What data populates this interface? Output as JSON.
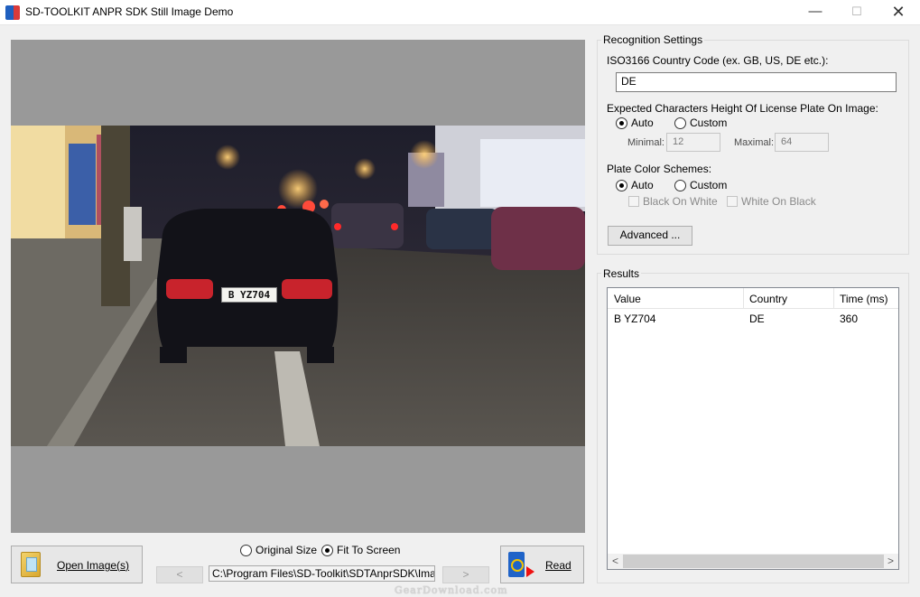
{
  "window": {
    "title": "SD-TOOLKIT ANPR SDK Still Image Demo",
    "controls": {
      "minimize": "—",
      "maximize": "☐",
      "close": "✕"
    }
  },
  "viewer": {
    "plate_text": "B YZ704"
  },
  "toolbar": {
    "open_label": "Open Image(s)",
    "read_label": "Read",
    "original_size_label": "Original Size",
    "fit_to_screen_label": "Fit To Screen",
    "fit_to_screen_selected": true,
    "prev_label": "<",
    "next_label": ">",
    "path": "C:\\Program Files\\SD-Toolkit\\SDTAnprSDK\\Images\\de"
  },
  "settings": {
    "group_title": "Recognition Settings",
    "country_code_label": "ISO3166 Country Code (ex. GB, US, DE etc.):",
    "country_code_value": "DE",
    "char_height_label": "Expected Characters Height Of License Plate On Image:",
    "char_height_auto": "Auto",
    "char_height_custom": "Custom",
    "char_height_selected": "Auto",
    "minimal_label": "Minimal:",
    "minimal_value": "12",
    "maximal_label": "Maximal:",
    "maximal_value": "64",
    "plate_color_label": "Plate Color Schemes:",
    "color_auto": "Auto",
    "color_custom": "Custom",
    "color_selected": "Auto",
    "black_on_white": "Black On White",
    "white_on_black": "White On Black",
    "advanced_label": "Advanced ..."
  },
  "results": {
    "group_title": "Results",
    "columns": [
      "Value",
      "Country",
      "Time (ms)"
    ],
    "rows": [
      {
        "value": "B YZ704",
        "country": "DE",
        "time": "360"
      }
    ],
    "scroll_left": "<",
    "scroll_right": ">"
  },
  "watermark": "GearDownload.com"
}
